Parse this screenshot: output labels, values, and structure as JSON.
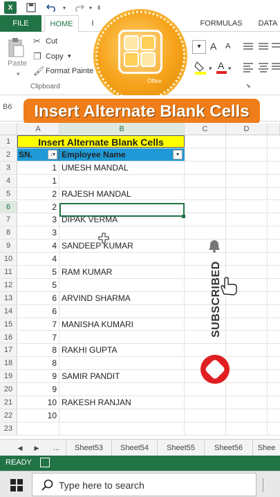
{
  "quick_access": {
    "logo": "X",
    "save_icon": "save-icon",
    "undo_icon": "undo-icon",
    "redo_icon": "redo-icon"
  },
  "tabs": {
    "file": "FILE",
    "home": "HOME",
    "partial": "I",
    "formulas": "FORMULAS",
    "data": "DATA"
  },
  "ribbon": {
    "paste": "Paste",
    "cut": "Cut",
    "copy": "Copy",
    "copy_arrow": "▾",
    "format_painter": "Format Painte",
    "clipboard_group": "Clipboard",
    "font_grow": "A",
    "font_shrink": "A"
  },
  "badge": {
    "word": "Office"
  },
  "formula_bar": {
    "name_box": "B6"
  },
  "banner": {
    "text": "Insert Alternate Blank Cells"
  },
  "columns": [
    "A",
    "B",
    "C",
    "D"
  ],
  "table": {
    "title": "Insert Alternate Blank Cells",
    "header_sn": "SN.",
    "header_name": "Employee Name",
    "rows": [
      {
        "row": "3",
        "sn": "1",
        "name": "UMESH MANDAL"
      },
      {
        "row": "4",
        "sn": "1",
        "name": ""
      },
      {
        "row": "5",
        "sn": "2",
        "name": "RAJESH MANDAL"
      },
      {
        "row": "6",
        "sn": "2",
        "name": ""
      },
      {
        "row": "7",
        "sn": "3",
        "name": "DIPAK VERMA"
      },
      {
        "row": "8",
        "sn": "3",
        "name": ""
      },
      {
        "row": "9",
        "sn": "4",
        "name": "SANDEEP KUMAR"
      },
      {
        "row": "10",
        "sn": "4",
        "name": ""
      },
      {
        "row": "11",
        "sn": "5",
        "name": "RAM KUMAR"
      },
      {
        "row": "12",
        "sn": "5",
        "name": ""
      },
      {
        "row": "13",
        "sn": "6",
        "name": "ARVIND SHARMA"
      },
      {
        "row": "14",
        "sn": "6",
        "name": ""
      },
      {
        "row": "15",
        "sn": "7",
        "name": "MANISHA KUMARI"
      },
      {
        "row": "16",
        "sn": "7",
        "name": ""
      },
      {
        "row": "17",
        "sn": "8",
        "name": "RAKHI GUPTA"
      },
      {
        "row": "18",
        "sn": "8",
        "name": ""
      },
      {
        "row": "19",
        "sn": "9",
        "name": "SAMIR PANDIT"
      },
      {
        "row": "20",
        "sn": "9",
        "name": ""
      },
      {
        "row": "21",
        "sn": "10",
        "name": "RAKESH RANJAN"
      },
      {
        "row": "22",
        "sn": "10",
        "name": ""
      },
      {
        "row": "23",
        "sn": "",
        "name": ""
      }
    ]
  },
  "sheets": {
    "more": "...",
    "tabs": [
      "Sheet53",
      "Sheet54",
      "Sheet55",
      "Sheet56",
      "Shee"
    ]
  },
  "status": {
    "text": "READY"
  },
  "taskbar": {
    "search_placeholder": "Type here to search"
  },
  "overlay": {
    "subscribe": "SUBSCRIBED"
  },
  "colors": {
    "excel_green": "#217346",
    "banner_orange": "#ef7d1a",
    "title_yellow": "#ffff00",
    "header_blue": "#1f9ad6"
  }
}
